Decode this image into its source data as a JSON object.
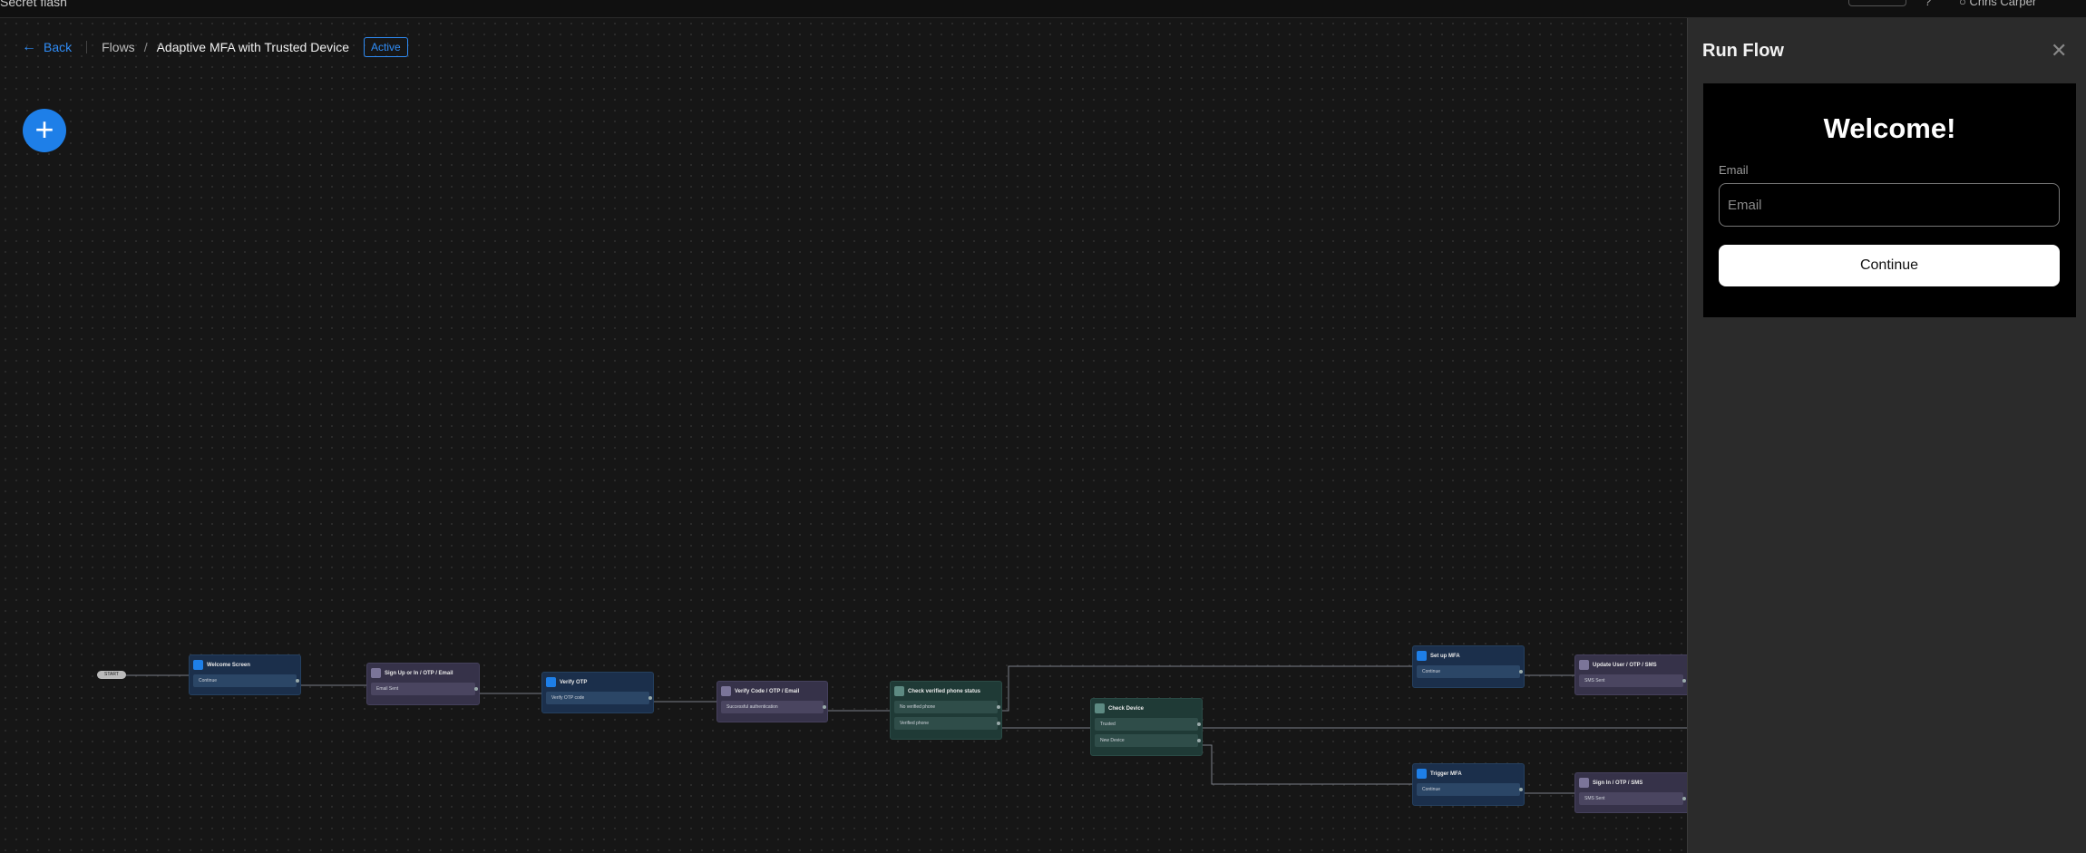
{
  "topbar": {
    "crumb": "Secret flash",
    "help_icon": "help-icon",
    "user_label": "Chris Carper"
  },
  "header": {
    "back_label": "Back",
    "back_icon": "arrow-left-icon",
    "crumb_root": "Flows",
    "crumb_sep": "/",
    "title": "Adaptive MFA with Trusted Device",
    "status_badge": "Active",
    "accent": "#2f8cf6"
  },
  "add_button": {
    "icon": "plus-icon",
    "label": "+"
  },
  "flow": {
    "start_label": "START",
    "nodes": {
      "welcome": {
        "title": "Welcome Screen",
        "options": [
          "Continue"
        ]
      },
      "signup": {
        "title": "Sign Up or In / OTP / Email",
        "options": [
          "Email Sent"
        ]
      },
      "verify_otp": {
        "title": "Verify OTP",
        "options": [
          "Verify OTP code"
        ]
      },
      "verify_code": {
        "title": "Verify Code / OTP / Email",
        "options": [
          "Successful authentication"
        ]
      },
      "check_phone": {
        "title": "Check verified phone status",
        "options": [
          "No verified phone",
          "Verified phone"
        ]
      },
      "check_device": {
        "title": "Check Device",
        "options": [
          "Trusted",
          "New Device"
        ]
      },
      "setup_mfa": {
        "title": "Set up MFA",
        "options": [
          "Continue"
        ]
      },
      "update_user": {
        "title": "Update User / OTP / SMS",
        "options": [
          "SMS Sent"
        ]
      },
      "trigger_mfa": {
        "title": "Trigger MFA",
        "options": [
          "Continue"
        ]
      },
      "signin_sms": {
        "title": "Sign In / OTP / SMS",
        "options": [
          "SMS Sent"
        ]
      }
    }
  },
  "run_flow": {
    "title": "Run Flow",
    "close_icon": "close-icon",
    "welcome_heading": "Welcome!",
    "email_label": "Email",
    "email_placeholder": "Email",
    "email_value": "",
    "continue_label": "Continue"
  }
}
